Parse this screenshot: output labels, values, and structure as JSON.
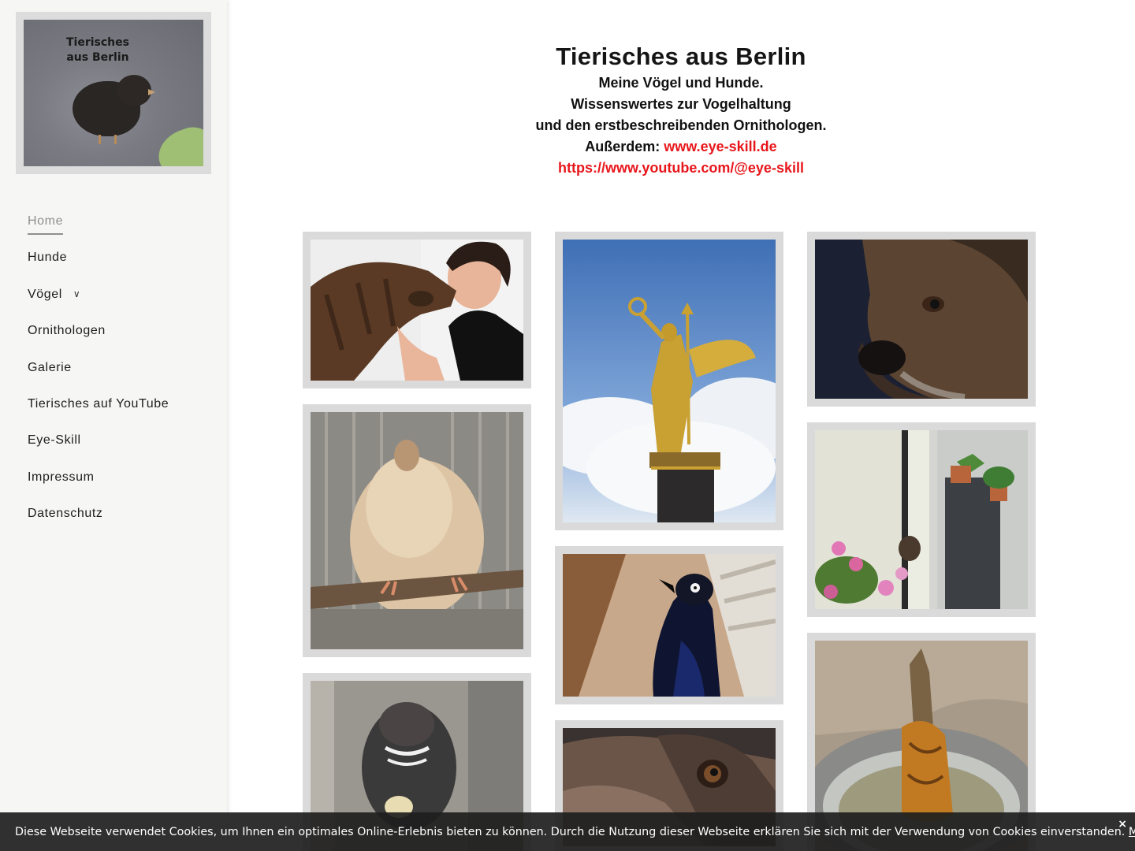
{
  "logo": {
    "line1": "Tierisches",
    "line2": "aus Berlin"
  },
  "nav": {
    "items": [
      {
        "label": "Home"
      },
      {
        "label": "Hunde"
      },
      {
        "label": "Vögel"
      },
      {
        "label": "Ornithologen"
      },
      {
        "label": "Galerie"
      },
      {
        "label": "Tierisches auf YouTube"
      },
      {
        "label": "Eye-Skill"
      },
      {
        "label": "Impressum"
      },
      {
        "label": "Datenschutz"
      }
    ],
    "active": "Home",
    "dropdown_icon": "chevron-down-icon"
  },
  "header": {
    "title": "Tierisches aus Berlin",
    "line1": "Meine Vögel und Hunde.",
    "line2": "Wissenswertes zur Vogelhaltung",
    "line3": "und den erstbeschreibenden Ornithologen.",
    "also_prefix": "Außerdem: ",
    "link1": "www.eye-skill.de",
    "link2": "https://www.youtube.com/@eye-skill"
  },
  "gallery": {
    "photos": [
      "dog-kissing-woman-photo",
      "victory-column-statue-photo",
      "dog-portrait-photo",
      "fluffy-bird-photo",
      "blackbird-photo",
      "balcony-dog-flowers-photo",
      "quail-photo",
      "shepherd-dog-photo",
      "bird-bathing-bowl-photo"
    ]
  },
  "cookie": {
    "text": "Diese Webseite verwendet Cookies, um Ihnen ein optimales Online-Erlebnis bieten zu können. Durch die Nutzung dieser Webseite erklären Sie sich mit der Verwendung von Cookies einverstanden. ",
    "link": "Mehr Infos",
    "close": "×"
  },
  "colors": {
    "accent_red": "#e8161b",
    "sidebar_bg": "#f6f6f4",
    "frame_gray": "#dadada"
  }
}
